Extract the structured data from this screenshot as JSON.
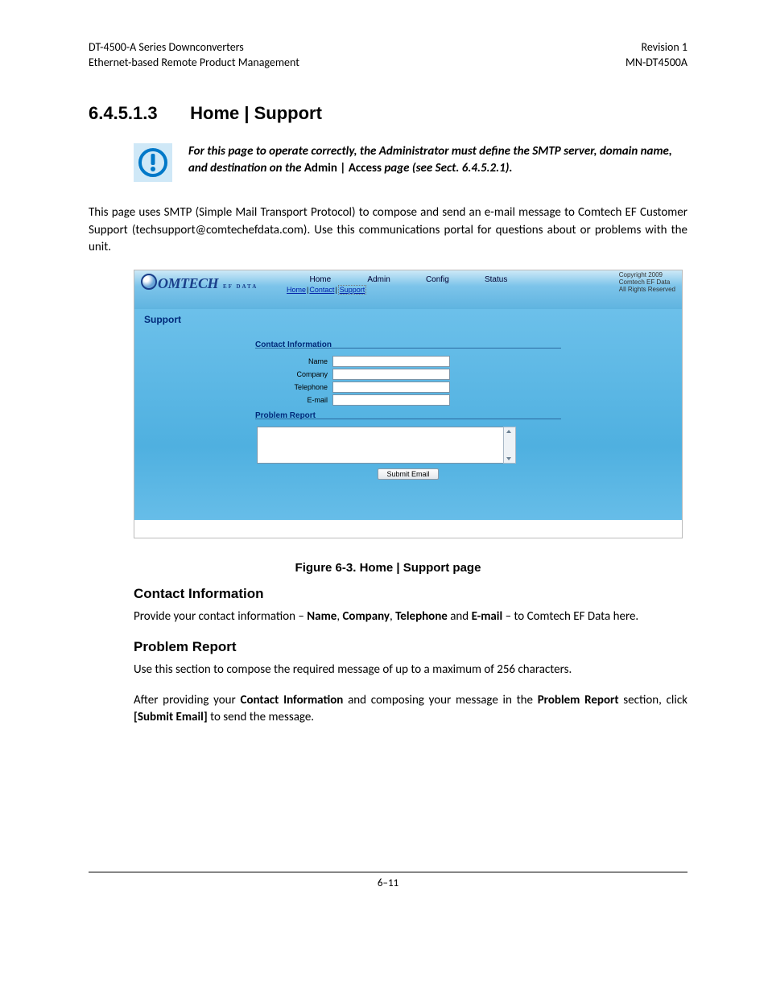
{
  "header": {
    "left1": "DT-4500-A Series Downconverters",
    "left2": "Ethernet-based Remote Product Management",
    "right1": "Revision 1",
    "right2": "MN-DT4500A"
  },
  "section": {
    "number": "6.4.5.1.3",
    "title": "Home | Support"
  },
  "notice": {
    "part1": "For this page to operate correctly, the Administrator must define the SMTP server, domain name, and destination on the ",
    "part2_plain_bold": "Admin | Access ",
    "part3": "page (see Sect. 6.4.5.2.1)."
  },
  "intro": "This page uses SMTP (Simple Mail Transport Protocol) to compose and send an e-mail message to Comtech EF Customer Support (techsupport@comtechefdata.com). Use this communications portal for questions about or problems with the unit.",
  "screenshot": {
    "logo_text": "OMTECH",
    "logo_sub": "EF DATA",
    "tabs": [
      "Home",
      "Admin",
      "Config",
      "Status"
    ],
    "subnav": {
      "home": "Home",
      "contact": "Contact",
      "support": "Support"
    },
    "copyright": {
      "l1": "Copyright 2009",
      "l2": "Comtech EF Data",
      "l3": "All Rights Reserved"
    },
    "page_heading": "Support",
    "panel1_title": "Contact Information",
    "fields": {
      "name": "Name",
      "company": "Company",
      "telephone": "Telephone",
      "email": "E-mail"
    },
    "panel2_title": "Problem Report",
    "submit": "Submit Email"
  },
  "caption": "Figure 6-3. Home | Support page",
  "contact_heading": "Contact Information",
  "contact_para": {
    "a": "Provide your contact information – ",
    "b1": "Name",
    "c1": ", ",
    "b2": "Company",
    "c2": ", ",
    "b3": "Telephone",
    "c3": " and ",
    "b4": "E-mail",
    "d": " – to Comtech EF Data here."
  },
  "problem_heading": "Problem Report",
  "problem_p1": "Use this section to compose the required message of up to a maximum of 256 characters.",
  "problem_p2": {
    "a": "After providing your ",
    "b1": "Contact Information",
    "c": " and composing your message in the ",
    "b2": "Problem Report",
    "d": " section, click ",
    "b3": "[Submit Email]",
    "e": " to send the message."
  },
  "footer": "6–11"
}
